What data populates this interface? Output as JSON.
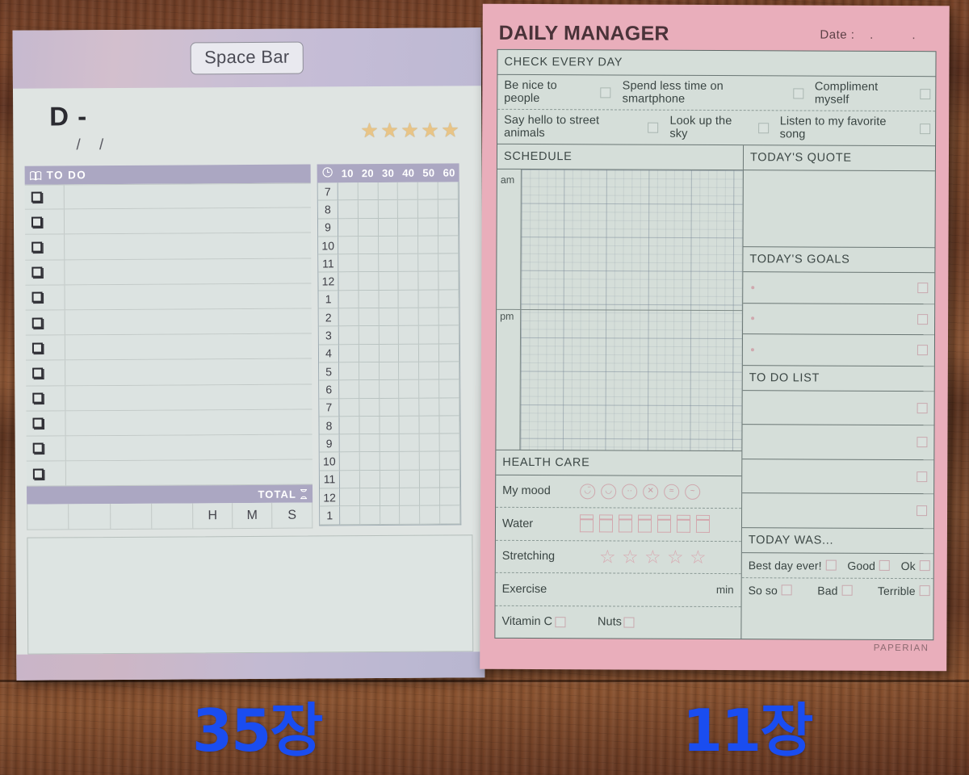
{
  "scene": {
    "background": "wooden-desk",
    "wood_color": "#6b3c25"
  },
  "left_pad": {
    "name": "Space Bar daily planner notepad",
    "sticker_label": "Space Bar",
    "header_color": "#c6b9cf",
    "paper_color": "#dfe4e2",
    "dday_label": "D -",
    "date_slashes": "/  /",
    "stars": {
      "count": 5,
      "glyph": "★",
      "color": "#e8c487"
    },
    "todo": {
      "icon": "open-book-icon",
      "header": "TO DO",
      "rows": 12,
      "total_label": "TOTAL",
      "total_icon": "hourglass-icon",
      "hms": [
        "H",
        "M",
        "S"
      ]
    },
    "time_grid": {
      "icon": "clock-icon",
      "minute_columns": [
        "10",
        "20",
        "30",
        "40",
        "50",
        "60"
      ],
      "hours": [
        "7",
        "8",
        "9",
        "10",
        "11",
        "12",
        "1",
        "2",
        "3",
        "4",
        "5",
        "6",
        "7",
        "8",
        "9",
        "10",
        "11",
        "12",
        "1"
      ]
    },
    "memo_box": "",
    "count_badge": "35장"
  },
  "right_pad": {
    "name": "Daily Manager notepad",
    "brand": "PAPERIAN",
    "border_color": "#e9aebb",
    "paper_color": "#d5ded9",
    "title": "DAILY MANAGER",
    "date_label": "Date :",
    "date_dots": ".  .",
    "check_every_day": {
      "title": "CHECK EVERY DAY",
      "rows": [
        [
          "Be nice to people",
          "Spend less time on smartphone",
          "Compliment myself"
        ],
        [
          "Say hello to street animals",
          "Look up the sky",
          "Listen to my favorite song"
        ]
      ]
    },
    "schedule": {
      "title": "SCHEDULE",
      "am_label": "am",
      "pm_label": "pm"
    },
    "health_care": {
      "title": "HEALTH CARE",
      "rows": [
        {
          "label": "My mood",
          "type": "mood-faces",
          "count": 6
        },
        {
          "label": "Water",
          "type": "water-cups",
          "count": 7
        },
        {
          "label": "Stretching",
          "type": "stretch-stars",
          "count": 5
        },
        {
          "label": "Exercise",
          "type": "minutes-input",
          "unit": "min"
        },
        {
          "label": "Vitamin C",
          "type": "checkbox-pair",
          "second_label": "Nuts"
        }
      ]
    },
    "todays_quote": {
      "title": "TODAY'S QUOTE",
      "value": ""
    },
    "todays_goals": {
      "title": "TODAY'S GOALS",
      "rows": 3
    },
    "to_do_list": {
      "title": "TO DO LIST",
      "rows": 4
    },
    "today_was": {
      "title": "TODAY WAS...",
      "options_row1": [
        "Best day ever!",
        "Good",
        "Ok"
      ],
      "options_row2": [
        "So so",
        "Bad",
        "Terrible"
      ]
    },
    "count_badge": "11장"
  }
}
